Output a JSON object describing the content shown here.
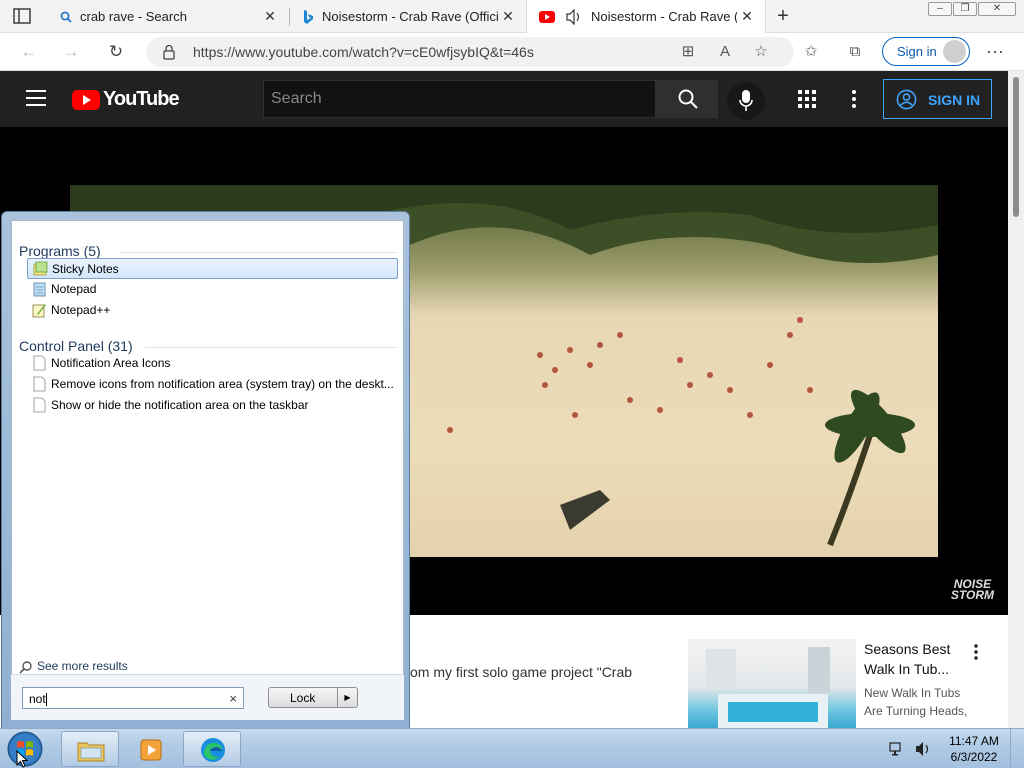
{
  "browser": {
    "tabs": [
      {
        "title": "crab rave - Search",
        "icon": "search-icon"
      },
      {
        "title": "Noisestorm - Crab Rave (Official",
        "icon": "bing-icon"
      },
      {
        "title": "Noisestorm - Crab Rave (Of",
        "icon": "youtube-icon",
        "active": true
      }
    ],
    "url": "https://www.youtube.com/watch?v=cE0wfjsybIQ&t=46s",
    "signin_label": "Sign in"
  },
  "youtube": {
    "logo_text": "YouTube",
    "search_placeholder": "Search",
    "signin_label": "SIGN IN",
    "watermark_line1": "NOISE",
    "watermark_line2": "STORM",
    "description_snippet": "om my first solo game project \"Crab",
    "recommended": {
      "title": "Seasons Best Walk In Tub...",
      "channel": "New Walk In Tubs Are Turning Heads, Discover..."
    }
  },
  "start_menu": {
    "programs_header": "Programs (5)",
    "programs": [
      {
        "label": "Sticky Notes",
        "icon": "sticky-notes-icon",
        "selected": true
      },
      {
        "label": "Notepad",
        "icon": "notepad-icon"
      },
      {
        "label": "Notepad++",
        "icon": "notepad-plus-plus-icon"
      }
    ],
    "control_panel_header": "Control Panel (31)",
    "control_panel": [
      {
        "label": "Notification Area Icons",
        "icon": "document-icon"
      },
      {
        "label": "Remove icons from notification area (system tray) on the deskt...",
        "icon": "document-icon"
      },
      {
        "label": "Show or hide the notification area on the taskbar",
        "icon": "document-icon"
      }
    ],
    "see_more": "See more results",
    "search_value": "not",
    "lock_label": "Lock"
  },
  "taskbar": {
    "time": "11:47 AM",
    "date": "6/3/2022"
  },
  "colors": {
    "youtube_red": "#ff0000",
    "yt_header": "#212121",
    "yt_blue": "#3ea6ff",
    "edge_blue": "#0a66c2"
  }
}
